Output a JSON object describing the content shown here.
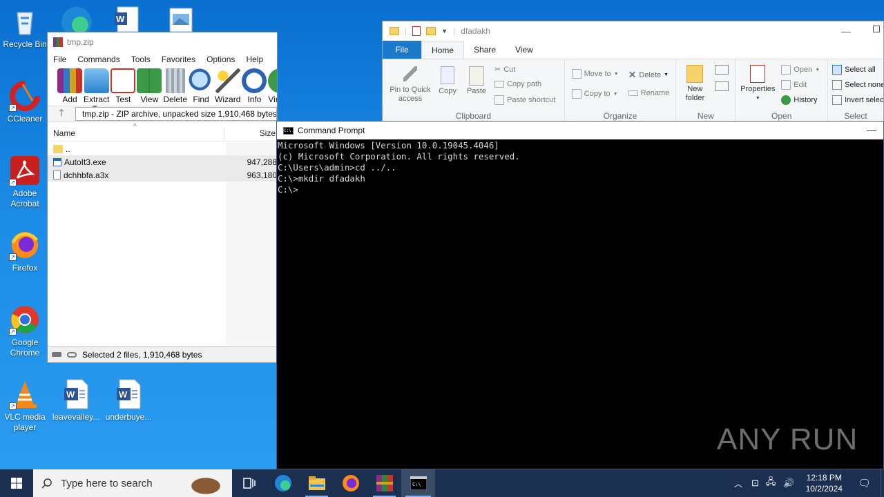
{
  "desktop": {
    "icons": [
      {
        "label": "Recycle Bin",
        "icon": "recycle-bin-icon"
      },
      {
        "label": "CCleaner",
        "icon": "ccleaner-icon"
      },
      {
        "label": "Adobe Acrobat",
        "icon": "adobe-acrobat-icon"
      },
      {
        "label": "Firefox",
        "icon": "firefox-icon"
      },
      {
        "label": "Google Chrome",
        "icon": "chrome-icon"
      },
      {
        "label": "VLC media player",
        "icon": "vlc-icon"
      },
      {
        "label": "leavevalley...",
        "icon": "word-document-icon"
      },
      {
        "label": "underbuye...",
        "icon": "word-document-icon"
      }
    ]
  },
  "winrar": {
    "title": "tmp.zip",
    "menu": [
      "File",
      "Commands",
      "Tools",
      "Favorites",
      "Options",
      "Help"
    ],
    "toolbar": [
      "Add",
      "Extract To",
      "Test",
      "View",
      "Delete",
      "Find",
      "Wizard",
      "Info",
      "Vir"
    ],
    "path": "tmp.zip - ZIP archive, unpacked size 1,910,468 bytes",
    "columns": {
      "name": "Name",
      "size": "Size"
    },
    "files": [
      {
        "name": "..",
        "size": ""
      },
      {
        "name": "AutoIt3.exe",
        "size": "947,288"
      },
      {
        "name": "dchhbfa.a3x",
        "size": "963,180"
      }
    ],
    "status": "Selected 2 files, 1,910,468 bytes"
  },
  "explorer": {
    "title": "dfadakh",
    "tabs": [
      "File",
      "Home",
      "Share",
      "View"
    ],
    "clipboard": {
      "pin": "Pin to Quick access",
      "copy": "Copy",
      "paste": "Paste",
      "cut": "Cut",
      "copy_path": "Copy path",
      "paste_shortcut": "Paste shortcut",
      "label": "Clipboard"
    },
    "organize": {
      "move_to": "Move to",
      "copy_to": "Copy to",
      "delete": "Delete",
      "rename": "Rename",
      "label": "Organize"
    },
    "new": {
      "new_folder": "New folder",
      "label": "New"
    },
    "open": {
      "properties": "Properties",
      "open": "Open",
      "edit": "Edit",
      "history": "History",
      "label": "Open"
    },
    "select": {
      "select_all": "Select all",
      "select_none": "Select none",
      "invert": "Invert selection",
      "label": "Select"
    }
  },
  "cmd": {
    "title": "Command Prompt",
    "lines": [
      "Microsoft Windows [Version 10.0.19045.4046]",
      "(c) Microsoft Corporation. All rights reserved.",
      "",
      "C:\\Users\\admin>cd ../..",
      "",
      "C:\\>mkdir dfadakh",
      "",
      "C:\\>"
    ]
  },
  "watermark": "ANY RUN",
  "taskbar": {
    "search_placeholder": "Type here to search",
    "time": "12:18 PM",
    "date": "10/2/2024"
  }
}
